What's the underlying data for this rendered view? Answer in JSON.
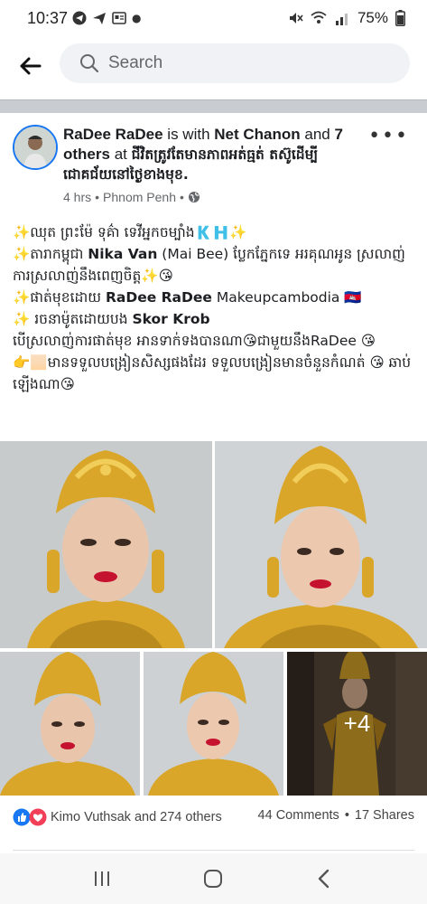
{
  "status_bar": {
    "time": "10:37",
    "battery": "75%"
  },
  "search": {
    "placeholder": "Search"
  },
  "post": {
    "author": "RaDee RaDee",
    "with_text": " is with ",
    "tagged": "Net Chanon",
    "and_text": " and ",
    "others_count": "7 others",
    "at_text": " at ",
    "place": "ជីវិតត្រូវតែមានភាពអត់ធ្មត់ តស៊ូដើម្បី ជោគជ័យនៅថ្ងៃខាងមុខ.",
    "time_ago": "4 hrs",
    "location": "Phnom Penh",
    "lines": [
      {
        "pre": "✨ឈុត ព្រះម៉ែ ទុគ៌ា ទេវីអ្នកចម្បាំង🇰🇭✨",
        "bold": "",
        "post": ""
      },
      {
        "pre": "✨តារាកម្ពុជា ",
        "bold": "Nika Van",
        "post": " (Mai Bee)  ប្លែកភ្នែកទេ អរគុណអូន ស្រលាញ់ការស្រលាញ់នឹងពេញចិត្ត✨😘"
      },
      {
        "pre": "✨ផាត់មុខដោយ ",
        "bold": "RaDee RaDee",
        "post": " Makeupcambodia 🇰🇭"
      },
      {
        "pre": "✨ រចនាម៉ូតដោយបង ",
        "bold": "Skor Krob",
        "post": ""
      },
      {
        "pre": "បើស្រលាញ់ការផាត់មុខ អានទាក់ទងបានណា😘ជាមួយនឹងRaDee 😘",
        "bold": "",
        "post": ""
      },
      {
        "pre": "👉🏻មានទទួលបង្រៀនសិស្សផងដែរ ទទួលបង្រៀនមានចំនួនកំណត់ 😘 ឆាប់ឡើងណា😘",
        "bold": "",
        "post": ""
      }
    ],
    "more_photos": "+4",
    "reactions_text": "Kimo Vuthsak and 274 others",
    "comments": "44 Comments",
    "shares": "17 Shares",
    "dot": "•"
  },
  "colors": {
    "brand_blue": "#1877f2",
    "gold": "#d9a62a",
    "lipstick": "#c4122f"
  }
}
